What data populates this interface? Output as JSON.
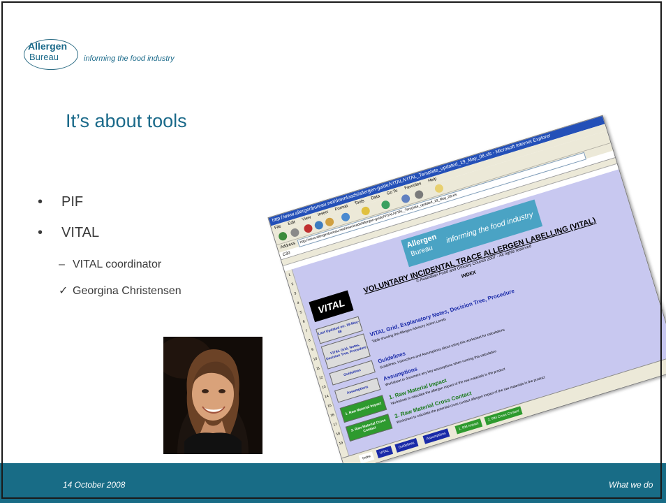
{
  "logo": {
    "word1": "Allergen",
    "word2": "Bureau",
    "tagline": "informing the food industry"
  },
  "slide": {
    "title": "It’s about tools",
    "bullets": [
      {
        "marker": "•",
        "text": "PIF"
      },
      {
        "marker": "•",
        "text": "VITAL"
      }
    ],
    "sub_bullets": [
      {
        "marker": "–",
        "text": "VITAL coordinator"
      },
      {
        "marker": "✓",
        "text": "Georgina Christensen"
      }
    ]
  },
  "screenshot": {
    "window_title": "http://www.allergenbureau.net/downloads/allergen-guide/VITAL/VITAL_Template_updated_19_May_08.xls - Microsoft Internet Explorer",
    "menu": [
      "File",
      "Edit",
      "View",
      "Insert",
      "Format",
      "Tools",
      "Data",
      "Go To",
      "Favorites",
      "Help"
    ],
    "address_label": "Address",
    "address": "http://www.allergenbureau.net/downloads/allergen-guide/VITAL/VITAL_Template_updated_19_May_08.xls",
    "cell_ref": "C30",
    "sheet_logo_word1": "Allergen",
    "sheet_logo_word2": "Bureau",
    "sheet_logo_tagline": "informing the food industry",
    "heading": "VOLUNTARY INCIDENTAL TRACE ALLERGEN LABELLING (VITAL)",
    "copyright": "© Australian Food and Grocery Council 2007 - All rights reserved",
    "index": "INDEX",
    "badge": "VITAL",
    "left_boxes": [
      "Last Updated on: 19-May-08",
      "VITAL Grid, Notes, Decision Tree, Procedure",
      "Guidelines",
      "Assumptions",
      "1. Raw Material Impact",
      "2. Raw Material Cross Contact"
    ],
    "sections": [
      {
        "title": "VITAL Grid, Explanatory Notes, Decision Tree, Procedure",
        "text": "Table showing the Allergen Advisory Action Levels"
      },
      {
        "title": "Guidelines",
        "text": "Guidelines, Instructions and Assumptions about using this worksheet for calculations"
      },
      {
        "title": "Assumptions",
        "text": "Worksheet to document any key assumptions when running this calculation"
      },
      {
        "title": "1. Raw Material Impact",
        "text": "Worksheet to calculate the allergen impact of the raw materials in the product"
      },
      {
        "title": "2. Raw Material Cross Contact",
        "text": "Worksheet to calculate the potential cross contact allergen impact of the raw materials in the product"
      }
    ],
    "tabs": [
      "Index",
      "VITAL",
      "Guidelines",
      "Assumptions",
      "1. RM Impact",
      "2. RM Cross Contact"
    ],
    "colors": {
      "sheet_background": "#c8c8f0",
      "heading_blue": "#1a2aa8",
      "green": "#2e9a2e"
    }
  },
  "footer": {
    "date": "14 October 2008",
    "right_text": "What we do"
  },
  "colors": {
    "brand_teal": "#1b6a8a",
    "footer_bar": "#186c86"
  }
}
